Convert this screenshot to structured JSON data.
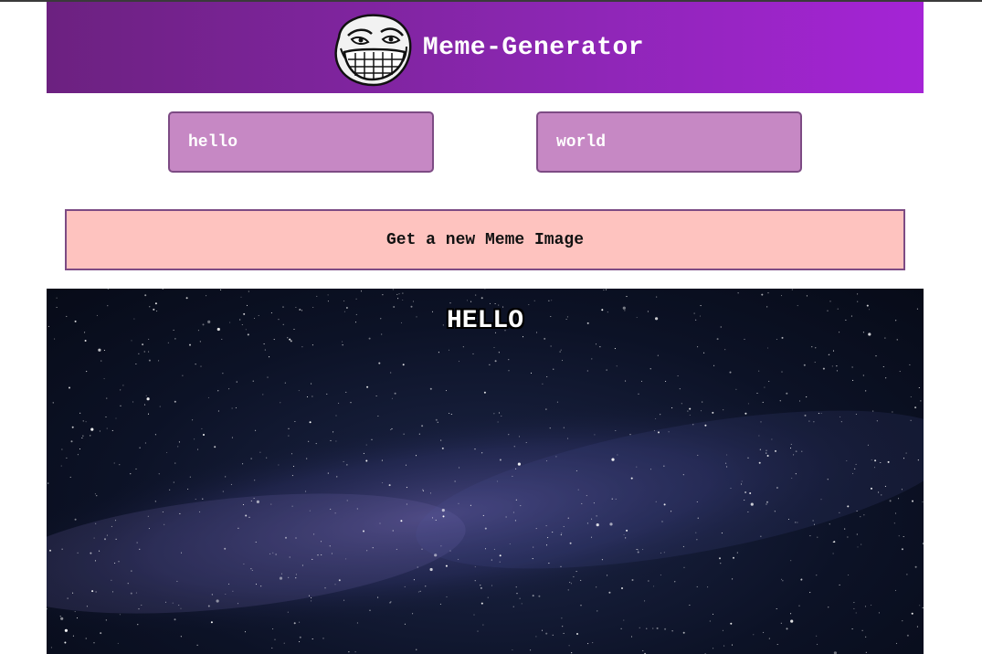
{
  "header": {
    "title": "Meme-Generator",
    "logo_icon": "trollface-icon"
  },
  "form": {
    "top_text_value": "hello",
    "bottom_text_value": "world",
    "submit_label": "Get a new Meme Image"
  },
  "meme": {
    "image": "milky-way-starry-sky",
    "top_text": "HELLO",
    "bottom_text": ""
  },
  "colors": {
    "header_gradient_start": "#6c2180",
    "header_gradient_end": "#a524d6",
    "input_background": "#c688c4",
    "input_border": "#7d4b84",
    "button_background": "#fec3bf"
  }
}
